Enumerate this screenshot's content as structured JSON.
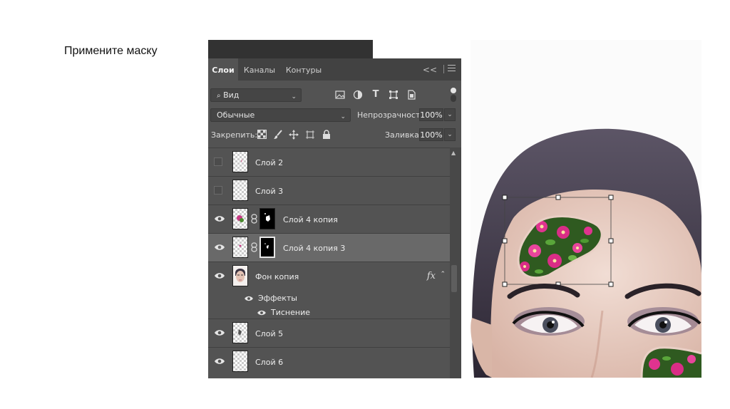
{
  "slide": {
    "title": "Примените маску"
  },
  "panel": {
    "tabs": [
      "Слои",
      "Каналы",
      "Контуры"
    ],
    "active_tab": 0,
    "filter": {
      "kind_label": "Вид"
    },
    "blend_mode": "Обычные",
    "opacity_label": "Непрозрачность:",
    "opacity_value": "100%",
    "lock_label": "Закрепить:",
    "fill_label": "Заливка:",
    "fill_value": "100%"
  },
  "layers": [
    {
      "name": "Слой 2",
      "visible": false,
      "has_mask": false,
      "selected": false
    },
    {
      "name": "Слой 3",
      "visible": false,
      "has_mask": false,
      "selected": false
    },
    {
      "name": "Слой 4 копия",
      "visible": true,
      "has_mask": true,
      "selected": false
    },
    {
      "name": "Слой 4 копия 3",
      "visible": true,
      "has_mask": true,
      "selected": true
    },
    {
      "name": "Фон копия",
      "visible": true,
      "has_mask": false,
      "selected": false,
      "fx": "fx",
      "effects_label": "Эффекты",
      "effect_items": [
        "Тиснение"
      ]
    },
    {
      "name": "Слой 5",
      "visible": true,
      "has_mask": false,
      "selected": false
    },
    {
      "name": "Слой 6",
      "visible": true,
      "has_mask": false,
      "selected": false
    }
  ],
  "colors": {
    "panel_bg": "#535353",
    "tabbar_bg": "#424242",
    "selected_row": "#696969",
    "flower_pink": "#e0338f",
    "leaf_green": "#3f8a2a"
  }
}
